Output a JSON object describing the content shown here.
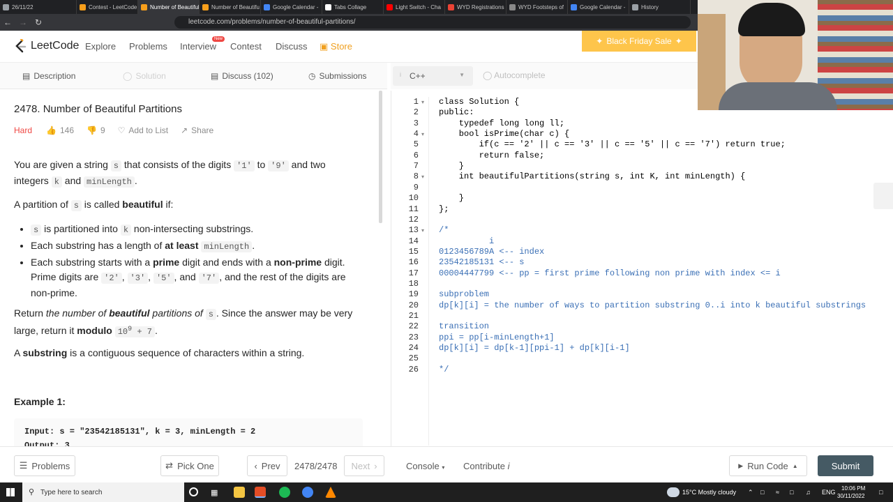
{
  "browser": {
    "tabs": [
      {
        "label": "26/11/22",
        "color": "#9aa0a6"
      },
      {
        "label": "Contest - LeetCode",
        "color": "#f89f1b"
      },
      {
        "label": "Number of Beautiful",
        "color": "#f89f1b",
        "active": true,
        "close": "x"
      },
      {
        "label": "Number of Beautifu",
        "color": "#f89f1b"
      },
      {
        "label": "Google Calendar - ",
        "color": "#4285f4"
      },
      {
        "label": "Tabs Collage",
        "color": "#ffffff"
      },
      {
        "label": "Light Switch - Cha",
        "color": "#ff0000"
      },
      {
        "label": "WYD Registrations",
        "color": "#ea4335"
      },
      {
        "label": "WYD Footsteps of",
        "color": "#888888"
      },
      {
        "label": "Google Calendar - ",
        "color": "#4285f4"
      },
      {
        "label": "History",
        "color": "#9aa0a6"
      }
    ],
    "url": "leetcode.com/problems/number-of-beautiful-partitions/"
  },
  "leetcode_nav": {
    "logo": "LeetCode",
    "explore": "Explore",
    "problems": "Problems",
    "interview": "Interview",
    "new_badge": "New",
    "contest": "Contest",
    "discuss": "Discuss",
    "store": "Store",
    "sale": "Black Friday Sale"
  },
  "left_tabs": {
    "description": "Description",
    "solution": "Solution",
    "discuss": "Discuss (102)",
    "submissions": "Submissions"
  },
  "problem": {
    "title": "2478. Number of Beautiful Partitions",
    "difficulty": "Hard",
    "likes": "146",
    "dislikes": "9",
    "add_to_list": "Add to List",
    "share": "Share",
    "example_heading": "Example 1:",
    "example_input": "Input: s = \"23542185131\", k = 3, minLength = 2",
    "example_output": "Output: 3"
  },
  "editor": {
    "language": "C++",
    "autocomplete": "Autocomplete",
    "lines": [
      "class Solution {",
      "public:",
      "    typedef long long ll;",
      "    bool isPrime(char c) {",
      "        if(c == '2' || c == '3' || c == '5' || c == '7') return true;",
      "        return false;",
      "    }",
      "    int beautifulPartitions(string s, int K, int minLength) {",
      "",
      "    }",
      "};",
      "",
      "/*",
      "          i",
      "0123456789A <-- index",
      "23542185131 <-- s",
      "00004447799 <-- pp = first prime following non prime with index <= i",
      "",
      "subproblem",
      "dp[k][i] = the number of ways to partition substring 0..i into k beautiful substrings",
      "",
      "transition",
      "ppi = pp[i-minLength+1]",
      "dp[k][i] = dp[k-1][ppi-1] + dp[k][i-1]",
      "",
      "*/"
    ]
  },
  "bottom": {
    "problems": "Problems",
    "pick_one": "Pick One",
    "prev": "Prev",
    "counter": "2478/2478",
    "next": "Next",
    "console": "Console",
    "contribute": "Contribute",
    "run_code": "Run Code",
    "submit": "Submit"
  },
  "taskbar": {
    "search_placeholder": "Type here to search",
    "weather": "15°C  Mostly cloudy",
    "lang": "ENG",
    "time": "10:06 PM",
    "date": "30/11/2022"
  }
}
